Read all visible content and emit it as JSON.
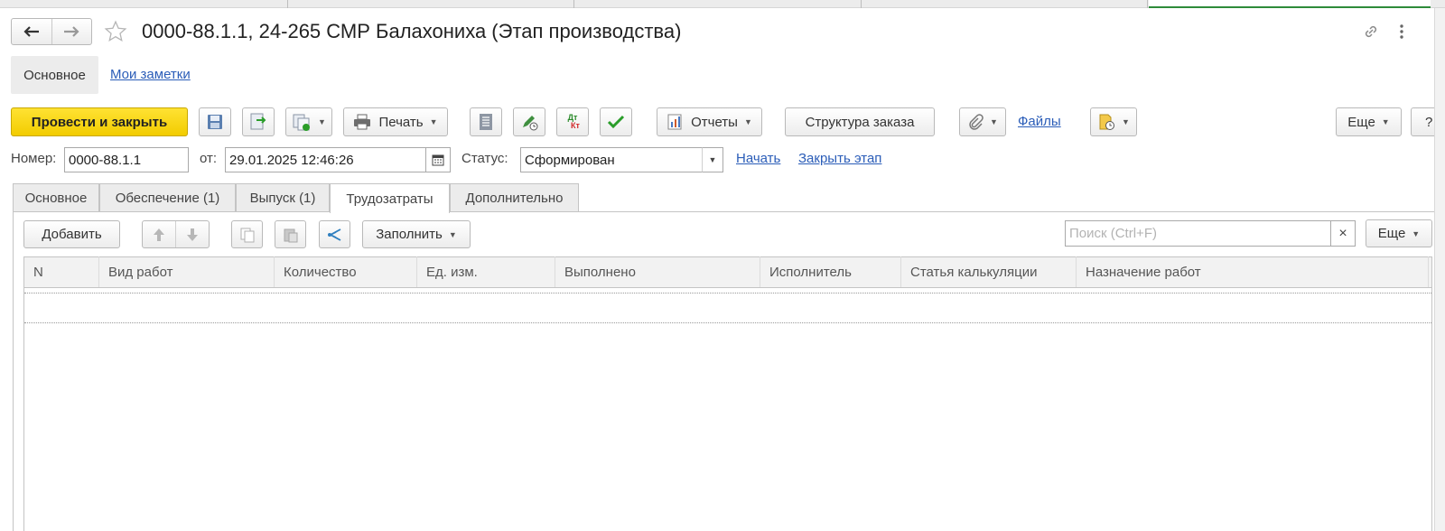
{
  "window_tabs_active_index": 5,
  "header": {
    "back_icon": "arrow-left-icon",
    "forward_icon": "arrow-right-icon",
    "favorite_icon": "star-icon",
    "title": "0000-88.1.1, 24-265 СМР Балахониха (Этап производства)",
    "link_icon": "link-icon",
    "menu_icon": "more-vertical-icon"
  },
  "nav": {
    "main": "Основное",
    "notes": "Мои заметки"
  },
  "toolbar": {
    "post_close": "Провести и закрыть",
    "print": "Печать",
    "reports": "Отчеты",
    "order_structure": "Структура заказа",
    "files": "Файлы",
    "more": "Еще",
    "help": "?",
    "dt_top": "Дт",
    "dt_bottom": "Кт"
  },
  "form": {
    "number_label": "Номер:",
    "number_value": "0000-88.1.1",
    "date_label": "от:",
    "date_value": "29.01.2025 12:46:26",
    "status_label": "Статус:",
    "status_value": "Сформирован",
    "start_link": "Начать",
    "close_stage_link": "Закрыть этап"
  },
  "tabs": [
    {
      "label": "Основное"
    },
    {
      "label": "Обеспечение (1)"
    },
    {
      "label": "Выпуск (1)"
    },
    {
      "label": "Трудозатраты"
    },
    {
      "label": "Дополнительно"
    }
  ],
  "active_tab": "Трудозатраты",
  "table_toolbar": {
    "add": "Добавить",
    "fill": "Заполнить",
    "search_placeholder": "Поиск (Ctrl+F)",
    "clear": "×",
    "more": "Еще"
  },
  "table": {
    "columns": [
      "N",
      "Вид работ",
      "Количество",
      "Ед. изм.",
      "Выполнено",
      "Исполнитель",
      "Статья калькуляции",
      "Назначение работ"
    ],
    "rows": []
  },
  "colors": {
    "primary_button": "#f5d200",
    "link": "#2b5db8",
    "active_window_tab": "#2e8b3a",
    "check_icon": "#2a9d2a"
  }
}
